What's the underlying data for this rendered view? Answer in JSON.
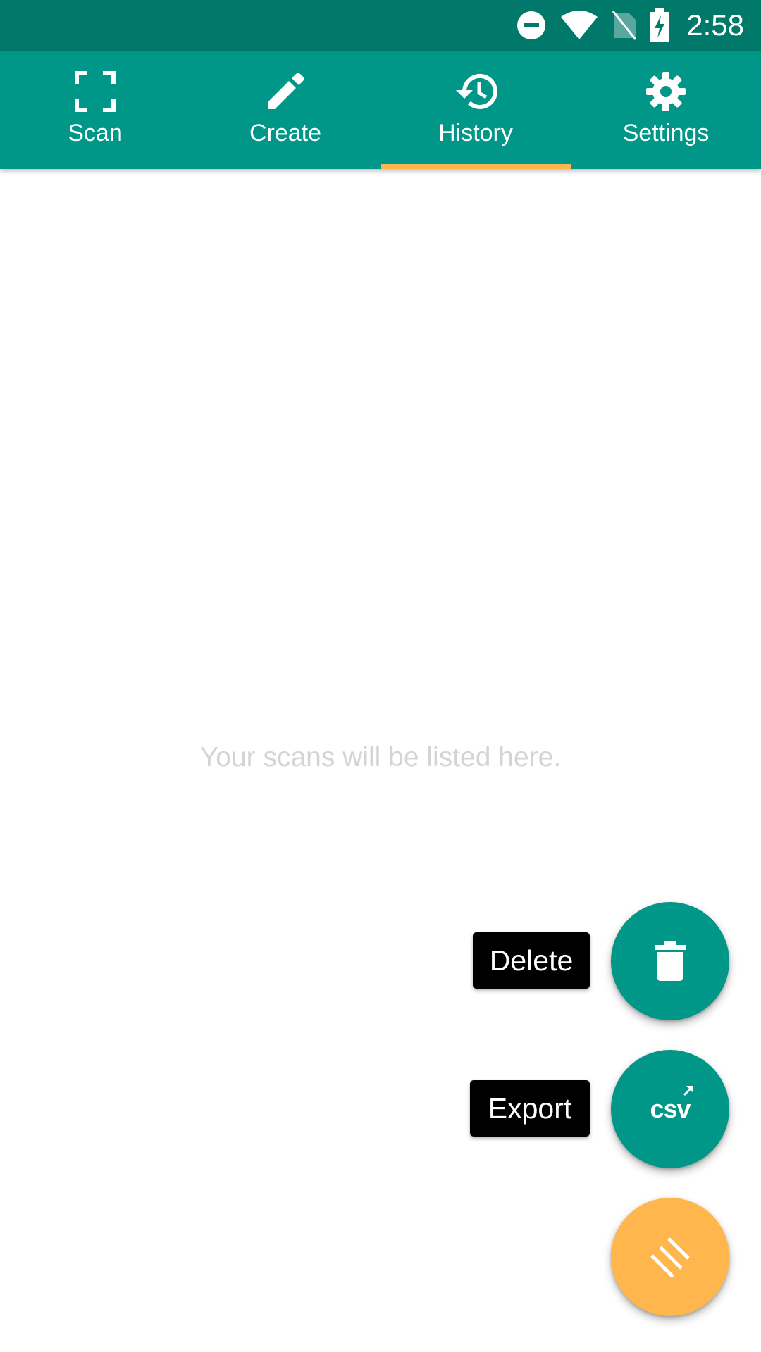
{
  "status_bar": {
    "time": "2:58",
    "icons": [
      "do-not-disturb-icon",
      "wifi-icon",
      "no-sim-icon",
      "battery-charging-icon"
    ]
  },
  "tabs": [
    {
      "label": "Scan",
      "icon": "scan-frame-icon",
      "selected": false
    },
    {
      "label": "Create",
      "icon": "pencil-icon",
      "selected": false
    },
    {
      "label": "History",
      "icon": "history-icon",
      "selected": true
    },
    {
      "label": "Settings",
      "icon": "gear-icon",
      "selected": false
    }
  ],
  "history": {
    "empty_message": "Your scans will be listed here."
  },
  "fab_menu": {
    "delete_label": "Delete",
    "export_label": "Export",
    "export_icon_text": "csv",
    "main_icon": "menu-lines-icon"
  },
  "colors": {
    "status_bar": "#00796B",
    "primary": "#009688",
    "accent": "#FFB74D",
    "empty_text": "#D4D4D4"
  }
}
